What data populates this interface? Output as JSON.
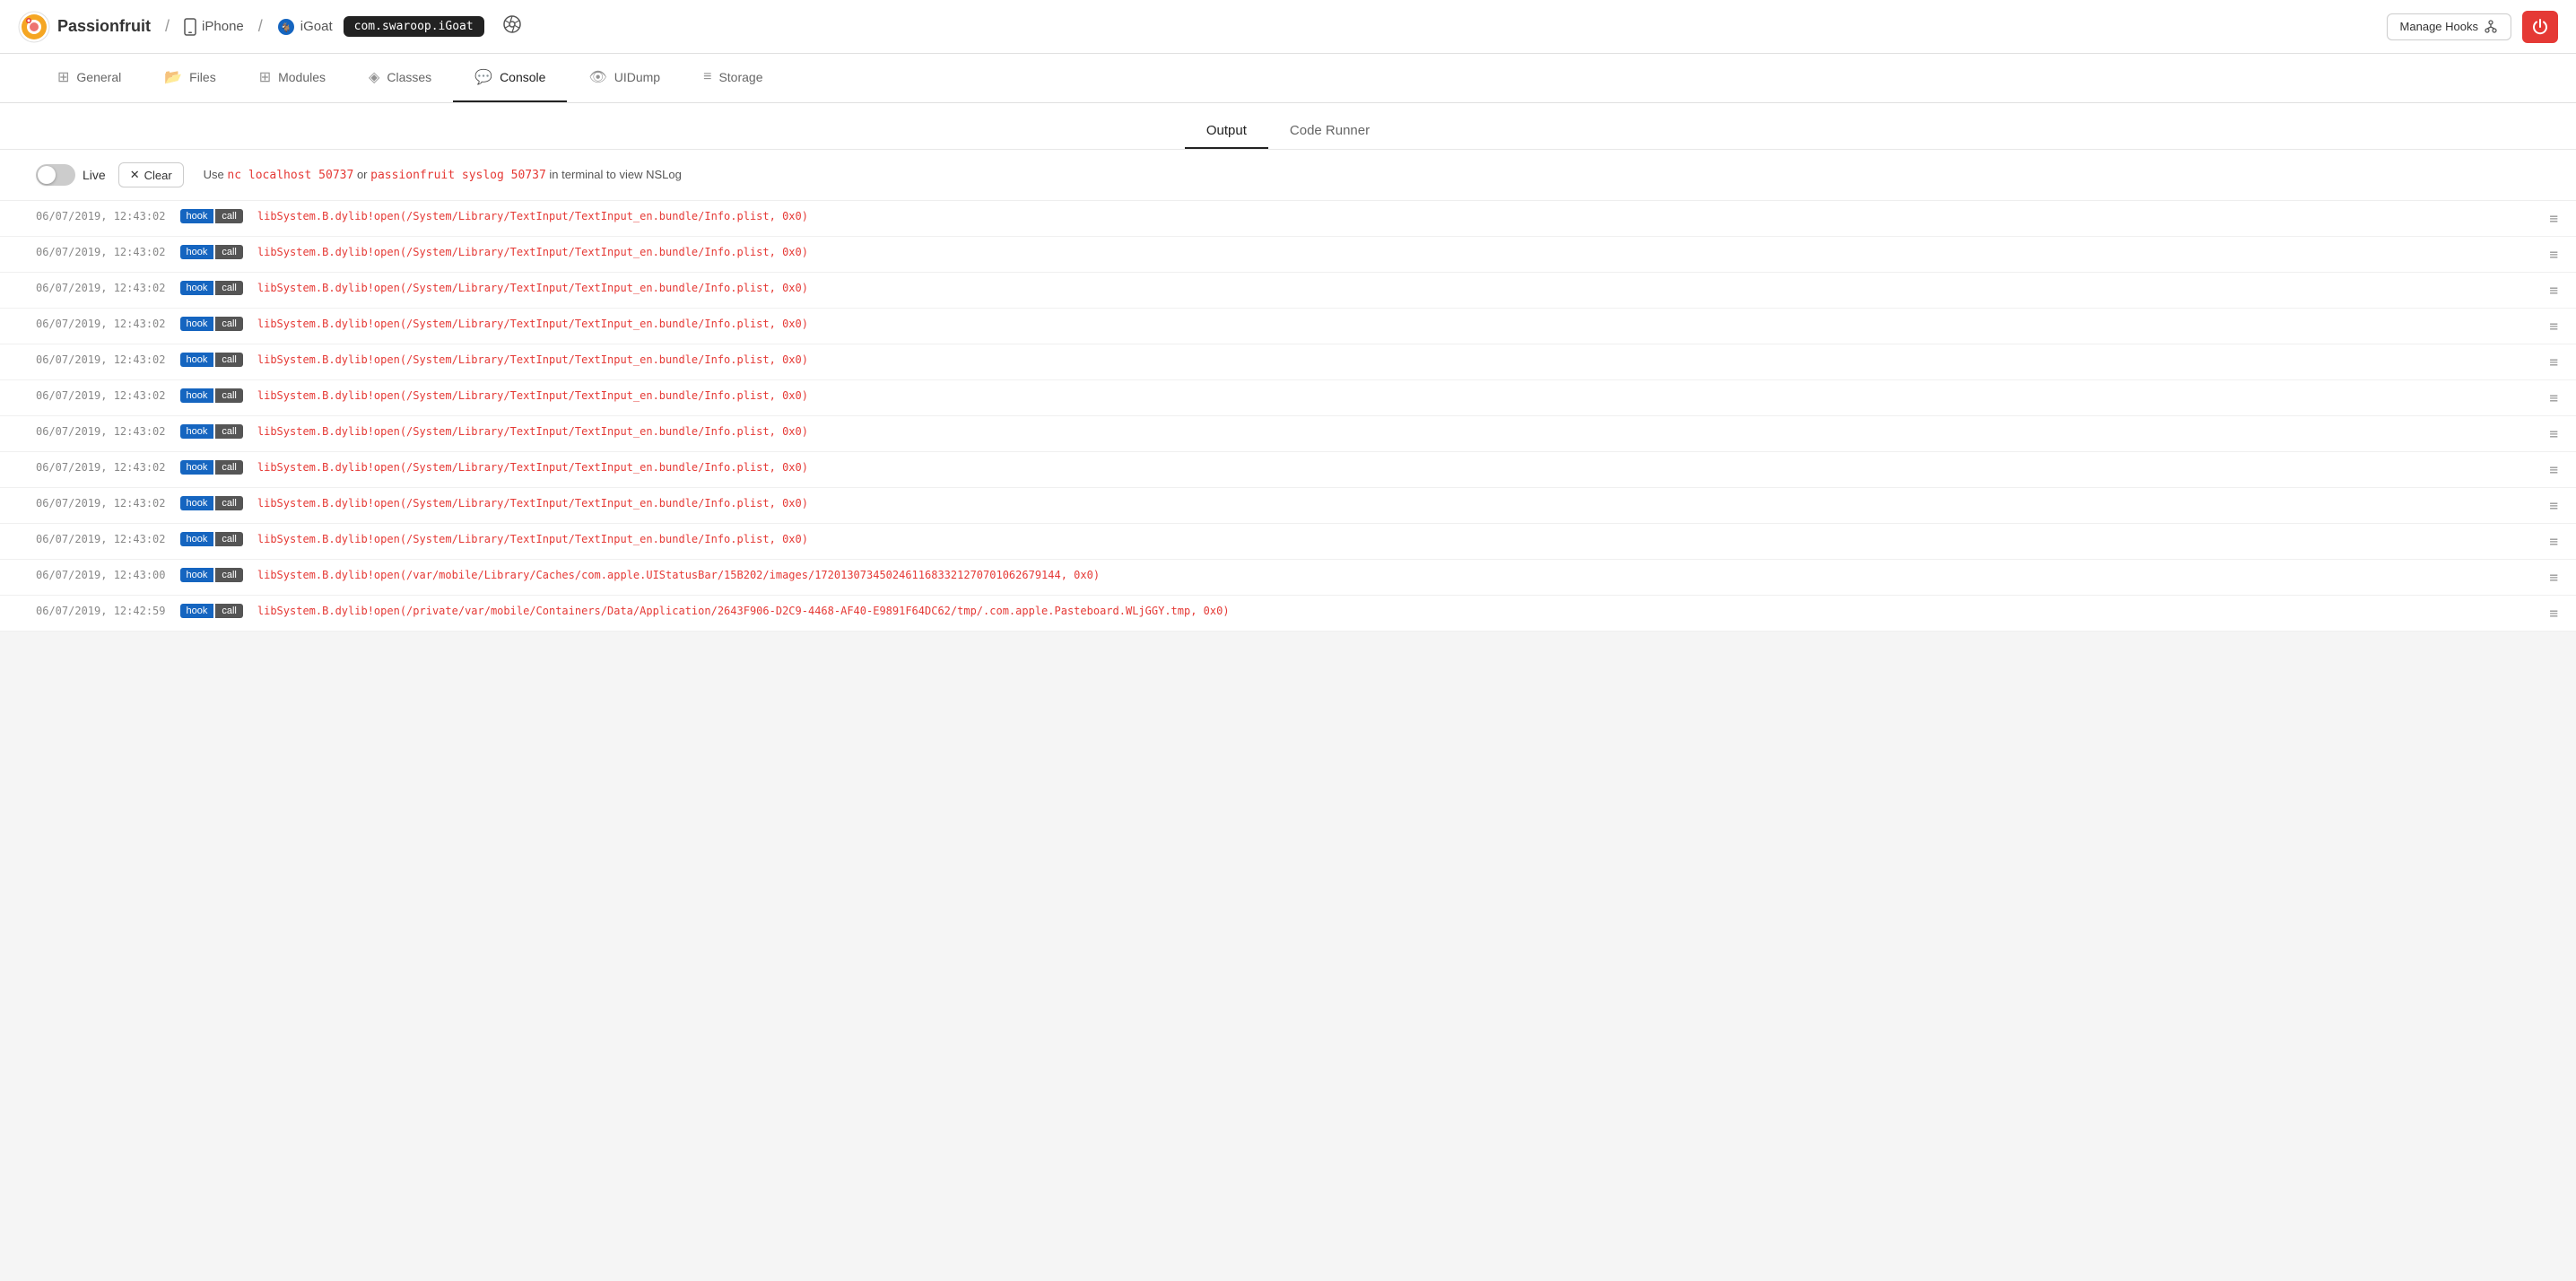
{
  "header": {
    "app_name": "Passionfruit",
    "device": "iPhone",
    "app": "iGoat",
    "bundle_id": "com.swaroop.iGoat",
    "manage_hooks_label": "Manage Hooks",
    "power_icon": "⏻"
  },
  "nav": {
    "tabs": [
      {
        "id": "general",
        "label": "General",
        "icon": "⊞"
      },
      {
        "id": "files",
        "label": "Files",
        "icon": "📁"
      },
      {
        "id": "modules",
        "label": "Modules",
        "icon": "⊞"
      },
      {
        "id": "classes",
        "label": "Classes",
        "icon": "◈"
      },
      {
        "id": "console",
        "label": "Console",
        "icon": "💬",
        "active": true
      },
      {
        "id": "uidump",
        "label": "UIDump",
        "icon": "👁"
      },
      {
        "id": "storage",
        "label": "Storage",
        "icon": "≡"
      }
    ]
  },
  "sub_tabs": [
    {
      "id": "output",
      "label": "Output",
      "active": true
    },
    {
      "id": "code_runner",
      "label": "Code Runner",
      "active": false
    }
  ],
  "toolbar": {
    "live_label": "Live",
    "clear_label": "Clear",
    "info_text_1": "Use",
    "code1": "nc localhost 50737",
    "info_text_2": "or",
    "code2": "passionfruit syslog 50737",
    "info_text_3": "in terminal to view NSLog"
  },
  "logs": [
    {
      "timestamp": "06/07/2019, 12:43:02",
      "badge_hook": "hook",
      "badge_call": "call",
      "message": "libSystem.B.dylib!open(/System/Library/TextInput/TextInput_en.bundle/Info.plist, 0x0)"
    },
    {
      "timestamp": "06/07/2019, 12:43:02",
      "badge_hook": "hook",
      "badge_call": "call",
      "message": "libSystem.B.dylib!open(/System/Library/TextInput/TextInput_en.bundle/Info.plist, 0x0)"
    },
    {
      "timestamp": "06/07/2019, 12:43:02",
      "badge_hook": "hook",
      "badge_call": "call",
      "message": "libSystem.B.dylib!open(/System/Library/TextInput/TextInput_en.bundle/Info.plist, 0x0)"
    },
    {
      "timestamp": "06/07/2019, 12:43:02",
      "badge_hook": "hook",
      "badge_call": "call",
      "message": "libSystem.B.dylib!open(/System/Library/TextInput/TextInput_en.bundle/Info.plist, 0x0)"
    },
    {
      "timestamp": "06/07/2019, 12:43:02",
      "badge_hook": "hook",
      "badge_call": "call",
      "message": "libSystem.B.dylib!open(/System/Library/TextInput/TextInput_en.bundle/Info.plist, 0x0)"
    },
    {
      "timestamp": "06/07/2019, 12:43:02",
      "badge_hook": "hook",
      "badge_call": "call",
      "message": "libSystem.B.dylib!open(/System/Library/TextInput/TextInput_en.bundle/Info.plist, 0x0)"
    },
    {
      "timestamp": "06/07/2019, 12:43:02",
      "badge_hook": "hook",
      "badge_call": "call",
      "message": "libSystem.B.dylib!open(/System/Library/TextInput/TextInput_en.bundle/Info.plist, 0x0)"
    },
    {
      "timestamp": "06/07/2019, 12:43:02",
      "badge_hook": "hook",
      "badge_call": "call",
      "message": "libSystem.B.dylib!open(/System/Library/TextInput/TextInput_en.bundle/Info.plist, 0x0)"
    },
    {
      "timestamp": "06/07/2019, 12:43:02",
      "badge_hook": "hook",
      "badge_call": "call",
      "message": "libSystem.B.dylib!open(/System/Library/TextInput/TextInput_en.bundle/Info.plist, 0x0)"
    },
    {
      "timestamp": "06/07/2019, 12:43:02",
      "badge_hook": "hook",
      "badge_call": "call",
      "message": "libSystem.B.dylib!open(/System/Library/TextInput/TextInput_en.bundle/Info.plist, 0x0)"
    },
    {
      "timestamp": "06/07/2019, 12:43:00",
      "badge_hook": "hook",
      "badge_call": "call",
      "message": "libSystem.B.dylib!open(/var/mobile/Library/Caches/com.apple.UIStatusBar/15B202/images/17201307345024611683321270701062679144, 0x0)"
    },
    {
      "timestamp": "06/07/2019, 12:42:59",
      "badge_hook": "hook",
      "badge_call": "call",
      "message": "libSystem.B.dylib!open(/private/var/mobile/Containers/Data/Application/2643F906-D2C9-4468-AF40-E9891F64DC62/tmp/.com.apple.Pasteboard.WLjGGY.tmp, 0x0)"
    }
  ]
}
